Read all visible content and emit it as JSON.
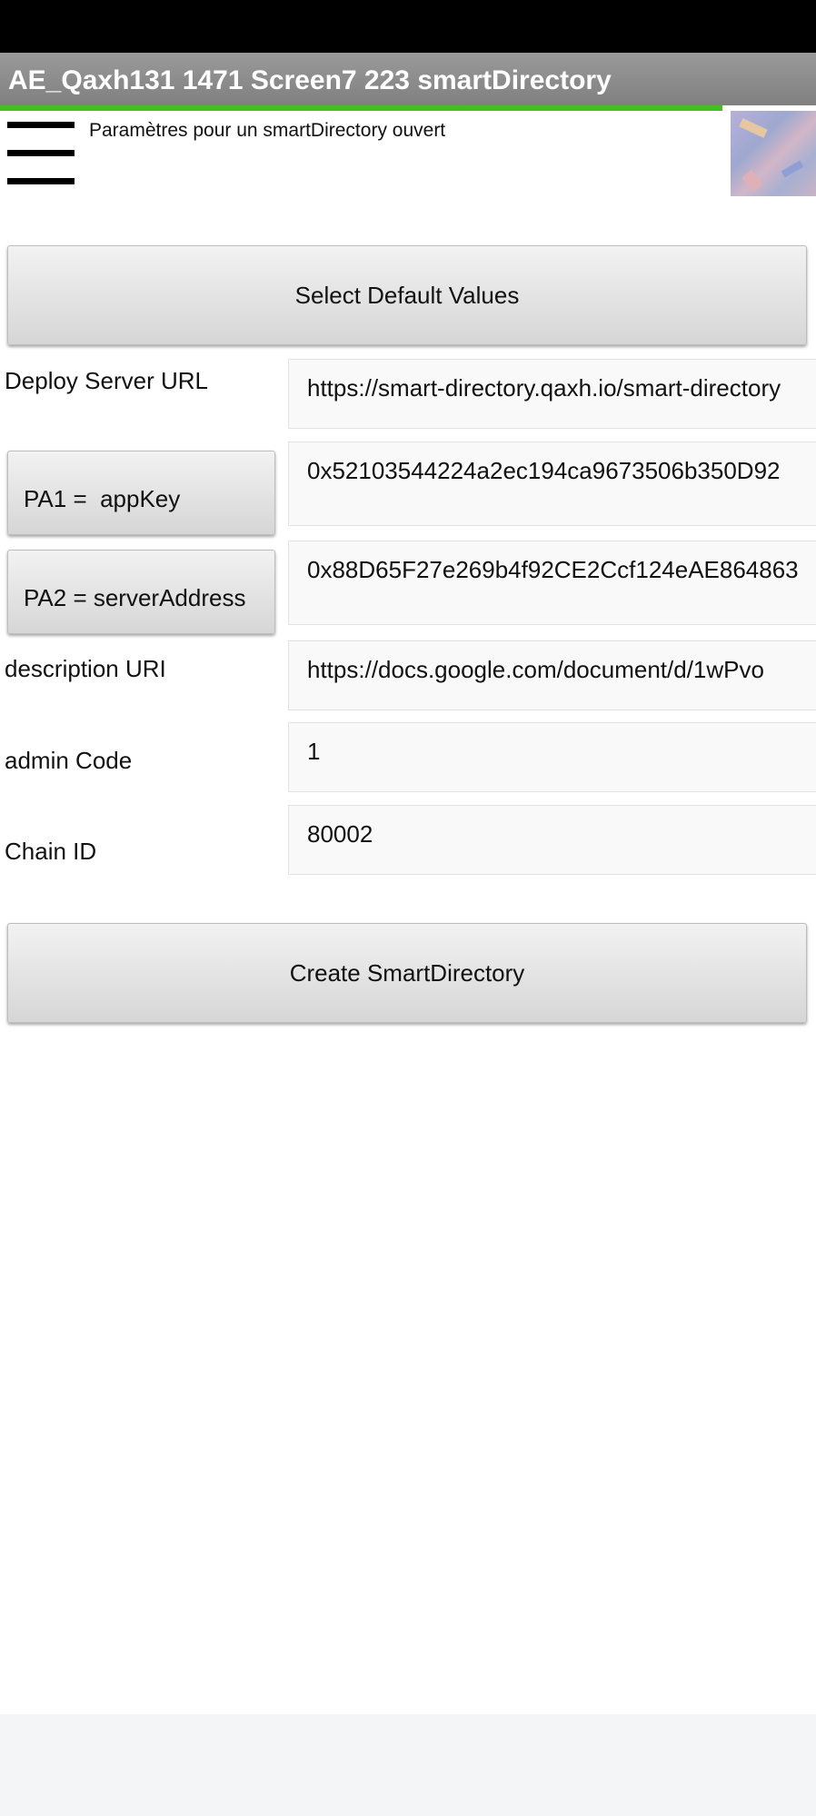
{
  "app": {
    "title": "AE_Qaxh131 1471 Screen7 223 smartDirectory",
    "subtitle": "Paramètres pour un smartDirectory ouvert",
    "progress_percent": 88.5,
    "accent_color": "#44c01e",
    "thumbnail_icon": "logo-thumbnail-image"
  },
  "buttons": {
    "select_default": "Select Default Values",
    "pa1": "PA1 =  appKey",
    "pa2": "PA2 = serverAddress",
    "create": "Create SmartDirectory"
  },
  "fields": {
    "deploy_server_url": {
      "label": "Deploy Server URL",
      "value": "https://smart-directory.qaxh.io/smart-directory"
    },
    "pa1_value": "0x52103544224a2ec194ca9673506b350D92",
    "pa2_value": "0x88D65F27e269b4f92CE2Ccf124eAE864863",
    "description_uri": {
      "label": "description URI",
      "value": "https://docs.google.com/document/d/1wPvo"
    },
    "admin_code": {
      "label": "admin Code",
      "value": "1"
    },
    "chain_id": {
      "label": "Chain ID",
      "value": "80002"
    }
  }
}
